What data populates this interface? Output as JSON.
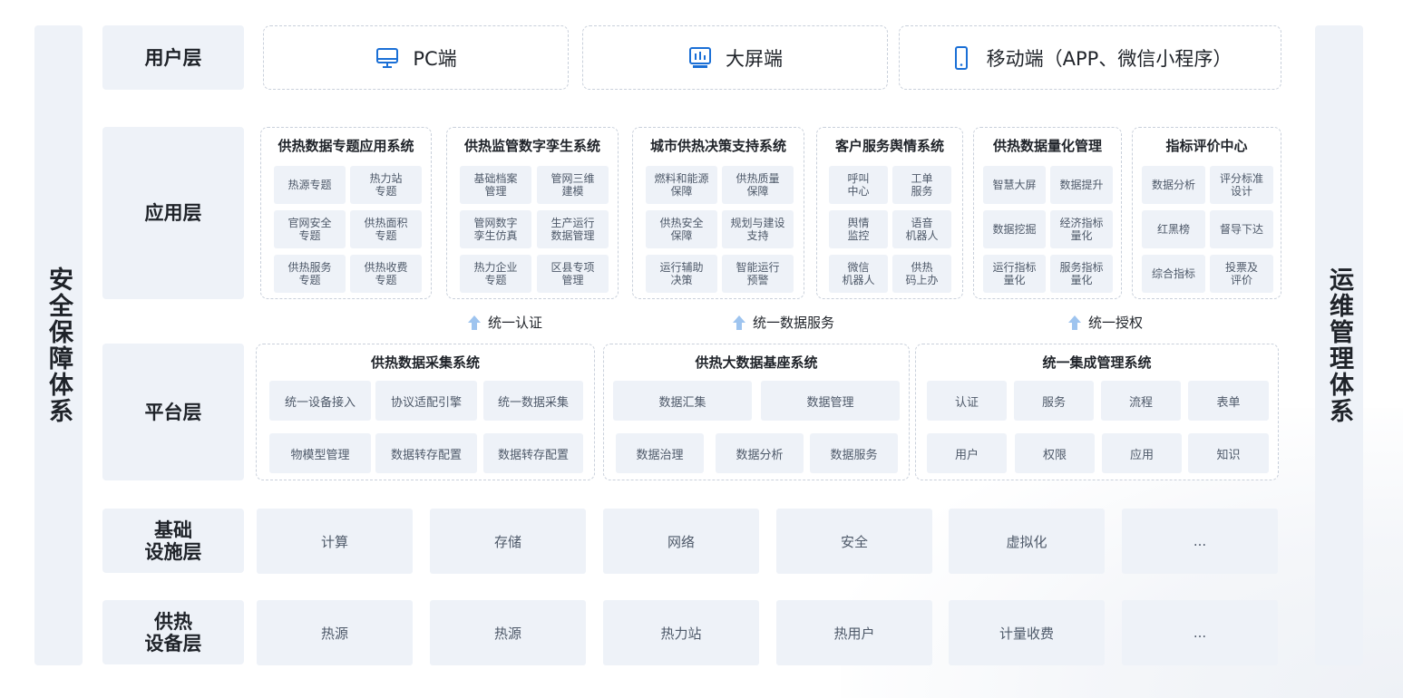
{
  "side": {
    "left": "安全保障体系",
    "right": "运维管理体系"
  },
  "layers": {
    "user": "用户层",
    "app": "应用层",
    "platform": "平台层",
    "infra": "基础\n设施层",
    "device": "供热\n设备层"
  },
  "user_layer": [
    {
      "label": "PC端",
      "icon": "monitor-icon"
    },
    {
      "label": "大屏端",
      "icon": "dashboard-screen-icon"
    },
    {
      "label": "移动端（APP、微信小程序）",
      "icon": "mobile-phone-icon"
    }
  ],
  "app_systems": [
    {
      "title": "供热数据专题应用系统",
      "items": [
        "热源专题",
        "热力站\n专题",
        "官网安全\n专题",
        "供热面积\n专题",
        "供热服务\n专题",
        "供热收费\n专题"
      ]
    },
    {
      "title": "供热监管数字孪生系统",
      "items": [
        "基础档案\n管理",
        "管网三维\n建模",
        "管网数字\n孪生仿真",
        "生产运行\n数据管理",
        "热力企业\n专题",
        "区县专项\n管理"
      ]
    },
    {
      "title": "城市供热决策支持系统",
      "items": [
        "燃料和能源\n保障",
        "供热质量\n保障",
        "供热安全\n保障",
        "规划与建设\n支持",
        "运行辅助\n决策",
        "智能运行\n预警"
      ]
    },
    {
      "title": "客户服务舆情系统",
      "items": [
        "呼叫\n中心",
        "工单\n服务",
        "舆情\n监控",
        "语音\n机器人",
        "微信\n机器人",
        "供热\n码上办"
      ]
    },
    {
      "title": "供热数据量化管理",
      "items": [
        "智慧大屏",
        "数据提升",
        "数据挖掘",
        "经济指标\n量化",
        "运行指标\n量化",
        "服务指标\n量化"
      ]
    },
    {
      "title": "指标评价中心",
      "items": [
        "数据分析",
        "评分标准\n设计",
        "红黑榜",
        "督导下达",
        "综合指标",
        "投票及\n评价"
      ]
    }
  ],
  "connectors": [
    "统一认证",
    "统一数据服务",
    "统一授权"
  ],
  "platform_systems": [
    {
      "title": "供热数据采集系统",
      "row1": [
        "统一设备接入",
        "协议适配引擎",
        "统一数据采集"
      ],
      "row2": [
        "物模型管理",
        "数据转存配置",
        "数据转存配置"
      ]
    },
    {
      "title": "供热大数据基座系统",
      "row1": [
        "数据汇集",
        "数据管理"
      ],
      "row2": [
        "数据治理",
        "数据分析",
        "数据服务"
      ]
    },
    {
      "title": "统一集成管理系统",
      "row1": [
        "认证",
        "服务",
        "流程",
        "表单"
      ],
      "row2": [
        "用户",
        "权限",
        "应用",
        "知识"
      ]
    }
  ],
  "infra_items": [
    "计算",
    "存储",
    "网络",
    "安全",
    "虚拟化",
    "..."
  ],
  "device_items": [
    "热源",
    "热源",
    "热力站",
    "热用户",
    "计量收费",
    "..."
  ],
  "colors": {
    "panel": "#eef2f8",
    "arrow": "#9ec4ef",
    "icon": "#1a6fd6",
    "dashed": "#c9d0db"
  }
}
